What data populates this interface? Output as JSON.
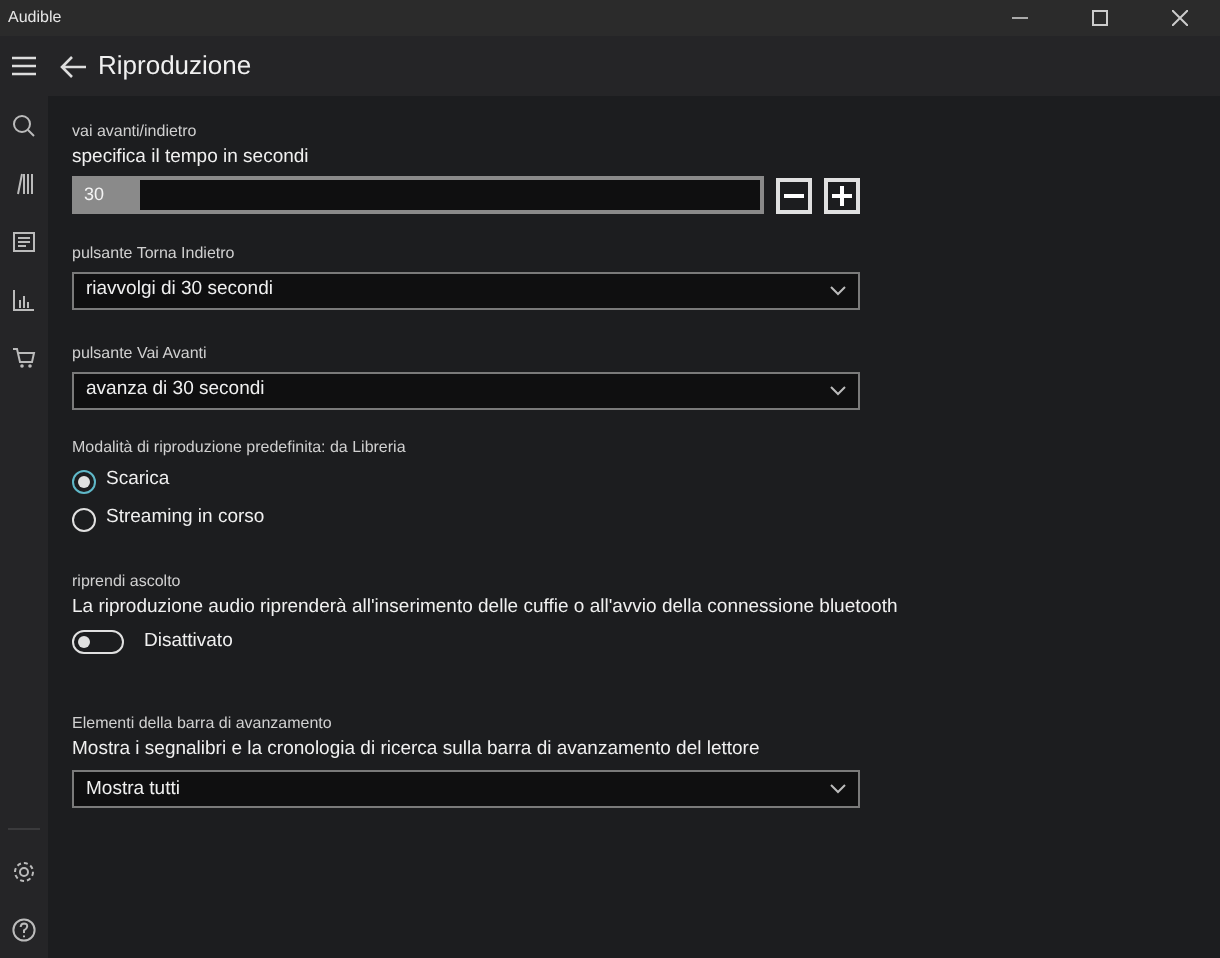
{
  "window": {
    "title": "Audible"
  },
  "header": {
    "title": "Riproduzione"
  },
  "rail": {
    "items": [
      {
        "kind": "search"
      },
      {
        "kind": "library"
      },
      {
        "kind": "list"
      },
      {
        "kind": "stats"
      },
      {
        "kind": "cart"
      }
    ],
    "bottom": [
      {
        "kind": "settings"
      },
      {
        "kind": "help"
      }
    ]
  },
  "seek": {
    "label": "vai avanti/indietro",
    "description": "specifica il tempo in secondi",
    "value": "30"
  },
  "back_button": {
    "label": "pulsante Torna Indietro",
    "value": "riavvolgi di 30 secondi"
  },
  "forward_button": {
    "label": "pulsante Vai Avanti",
    "value": "avanza di 30 secondi"
  },
  "playback_mode": {
    "label": "Modalità di riproduzione predefinita: da Libreria",
    "options": [
      {
        "label": "Scarica",
        "selected": true
      },
      {
        "label": "Streaming in corso",
        "selected": false
      }
    ]
  },
  "resume": {
    "label": "riprendi ascolto",
    "description": "La riproduzione audio riprenderà all'inserimento delle cuffie o all'avvio della connessione bluetooth",
    "on": false,
    "state_label": "Disattivato"
  },
  "progress_bar_items": {
    "label": "Elementi della barra di avanzamento",
    "description": "Mostra i segnalibri e la cronologia di ricerca sulla barra di avanzamento del lettore",
    "value": "Mostra tutti"
  }
}
